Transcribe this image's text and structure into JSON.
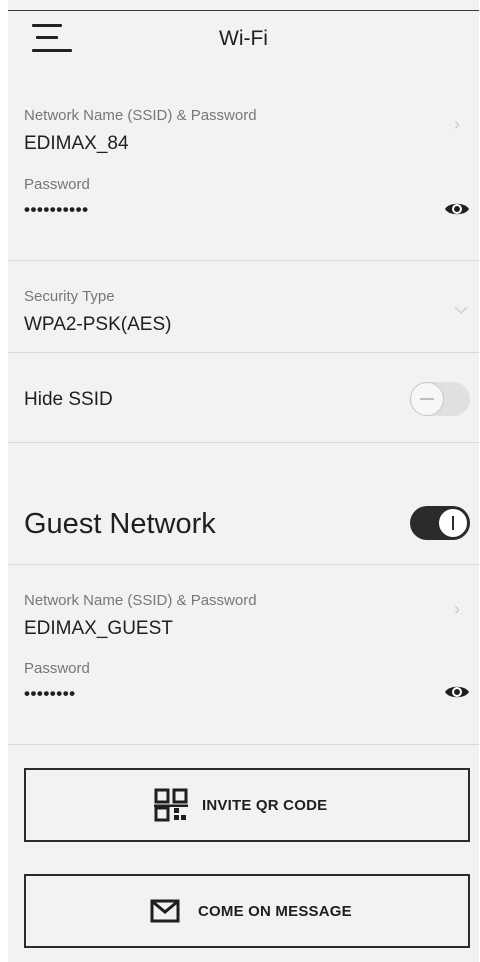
{
  "header": {
    "title": "Wi-Fi"
  },
  "main_network": {
    "ssid_label": "Network Name (SSID) & Password",
    "ssid_value": "EDIMAX_84",
    "password_label": "Password",
    "password_value": "••••••••••",
    "security_label": "Security Type",
    "security_value": "WPA2-PSK(AES)",
    "hide_ssid_label": "Hide SSID",
    "hide_ssid_enabled": false
  },
  "guest_network": {
    "title": "Guest Network",
    "enabled": true,
    "ssid_label": "Network Name (SSID) & Password",
    "ssid_value": "EDIMAX_GUEST",
    "password_label": "Password",
    "password_value": "••••••••"
  },
  "buttons": {
    "invite_qr": "INVITE QR CODE",
    "message": "COME ON MESSAGE"
  },
  "icons": {
    "menu": "menu-icon",
    "eye": "eye-icon",
    "chevron_right": "chevron-right-icon",
    "chevron_down": "chevron-down-icon",
    "qr": "qr-code-icon",
    "mail": "mail-icon"
  },
  "colors": {
    "toggle_on": "#2b2b2b",
    "toggle_off": "#e0e0e0",
    "background": "#f2f2f2"
  }
}
